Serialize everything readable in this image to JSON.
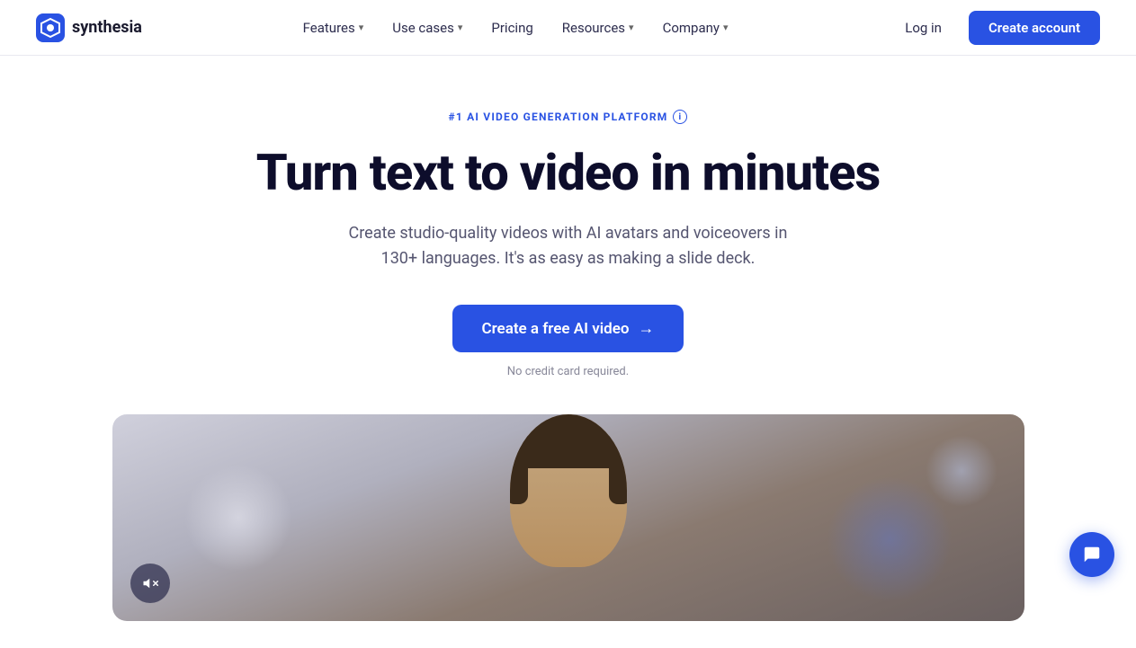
{
  "logo": {
    "text": "synthesia",
    "alt": "Synthesia logo"
  },
  "nav": {
    "links": [
      {
        "label": "Features",
        "hasDropdown": true
      },
      {
        "label": "Use cases",
        "hasDropdown": true
      },
      {
        "label": "Pricing",
        "hasDropdown": false
      },
      {
        "label": "Resources",
        "hasDropdown": true
      },
      {
        "label": "Company",
        "hasDropdown": true
      }
    ],
    "login_label": "Log in",
    "create_account_label": "Create account"
  },
  "hero": {
    "badge_text": "#1 AI VIDEO GENERATION PLATFORM",
    "title": "Turn text to video in minutes",
    "subtitle": "Create studio-quality videos with AI avatars and voiceovers in 130+ languages. It's as easy as making a slide deck.",
    "cta_label": "Create a free AI video",
    "cta_note": "No credit card required."
  },
  "icons": {
    "chevron": "▾",
    "arrow_right": "→",
    "mute": "🔇",
    "chat": "💬",
    "info": "i"
  },
  "colors": {
    "primary": "#2952e3",
    "badge": "#2952e3",
    "title": "#0d0d2b",
    "subtitle": "#555570"
  }
}
